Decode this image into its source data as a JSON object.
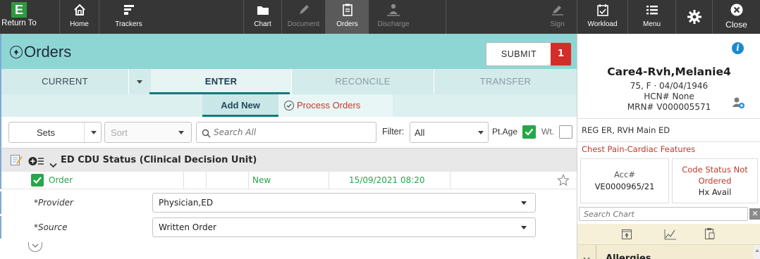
{
  "toolbar": {
    "return_to": "Return To",
    "home": "Home",
    "trackers": "Trackers",
    "chart": "Chart",
    "document": "Document",
    "orders": "Orders",
    "discharge": "Discharge",
    "sign": "Sign",
    "workload": "Workload",
    "menu": "Menu",
    "close": "Close",
    "logo_letter": "E"
  },
  "header": {
    "title": "Orders",
    "submit_label": "SUBMIT",
    "submit_count": "1"
  },
  "tabs": {
    "current": "CURRENT",
    "enter": "ENTER",
    "reconcile": "RECONCILE",
    "transfer": "TRANSFER"
  },
  "subtabs": {
    "add_new": "Add New",
    "process_orders": "Process Orders"
  },
  "filters": {
    "sets": "Sets",
    "sort": "Sort",
    "search_placeholder": "Search All",
    "filter_label": "Filter:",
    "filter_value": "All",
    "pt_age_label": "Pt.Age",
    "wt_label": "Wt."
  },
  "section": {
    "title": "ED CDU Status (Clinical Decision Unit)"
  },
  "order": {
    "name": "Order",
    "status": "New",
    "datetime": "15/09/2021 08:20",
    "fields": [
      {
        "label": "*Provider",
        "value": "Physician,ED"
      },
      {
        "label": "*Source",
        "value": "Written Order"
      }
    ]
  },
  "patient": {
    "name": "Care4-Rvh,Melanie4",
    "age_sex_dob": "75, F · 04/04/1946",
    "hcn": "HCN# None",
    "mrn": "MRN# V000005571",
    "location": "REG ER, RVH Main ED",
    "complaint": "Chest Pain-Cardiac Features",
    "acc_label": "Acc#",
    "acc_value": "VE0000965/21",
    "code_status_line1": "Code Status Not",
    "code_status_line2": "Ordered",
    "hx_avail": "Hx Avail",
    "search_chart_placeholder": "Search Chart",
    "allergies": "Allergies"
  },
  "colors": {
    "toolbar": "#363636",
    "header_teal": "#8ed6d4",
    "submit_badge": "#d32d2a",
    "check_green": "#25a74a",
    "alert_red": "#c0392b"
  }
}
